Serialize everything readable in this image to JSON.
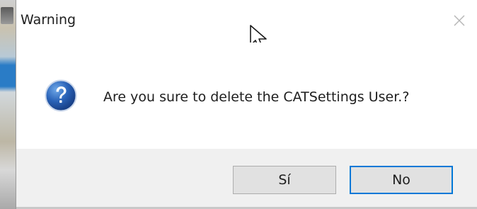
{
  "dialog": {
    "title": "Warning",
    "message": "Are you sure to delete the CATSettings User.?",
    "icon": "question-icon",
    "close_icon": "close-icon",
    "buttons": {
      "yes_label": "Sí",
      "no_label": "No"
    },
    "accent_color": "#0078d7",
    "footer_color": "#f0f0f0"
  }
}
